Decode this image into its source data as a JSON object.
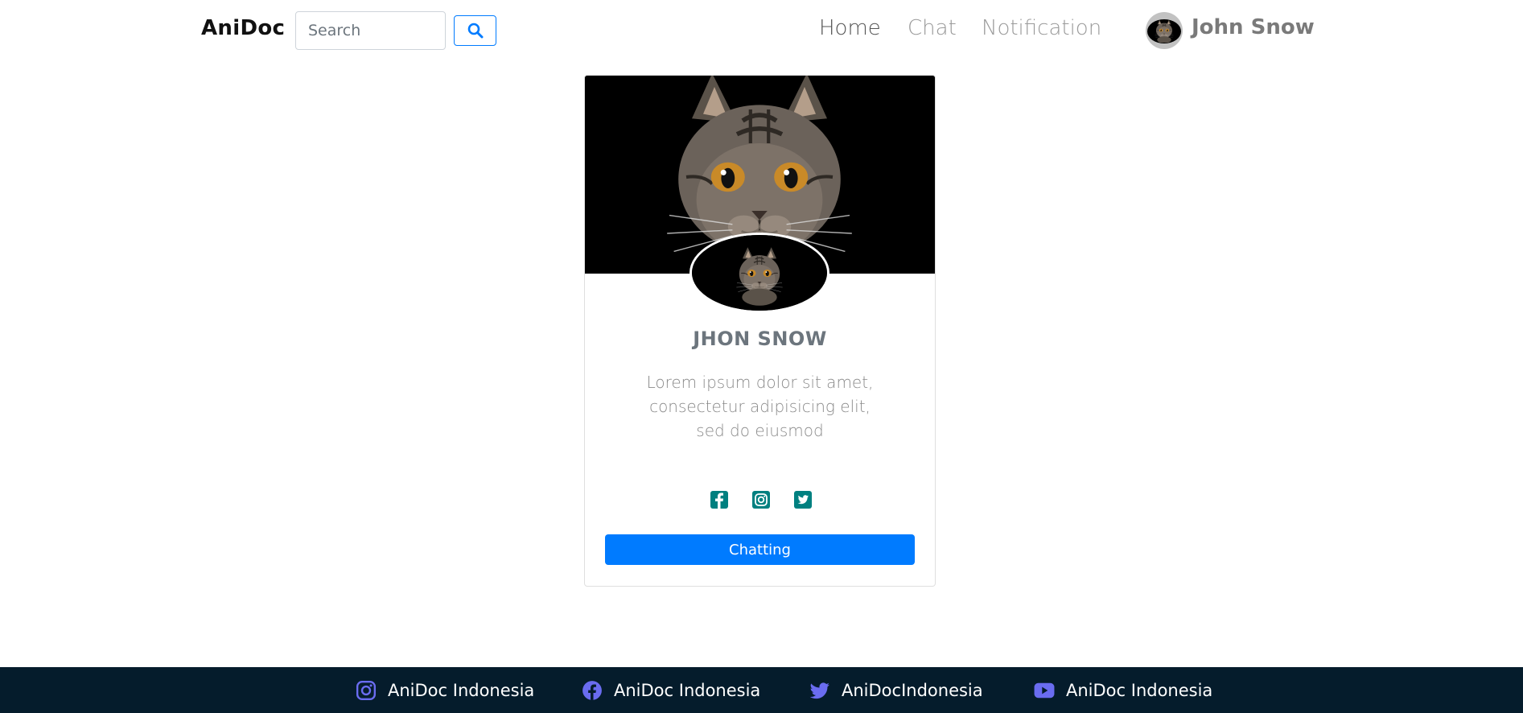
{
  "navbar": {
    "brand": "AniDoc",
    "search_placeholder": "Search",
    "links": {
      "home": "Home",
      "chat": "Chat",
      "notification": "Notification"
    },
    "user_name": "John Snow",
    "icons": {
      "search": "search-icon",
      "avatar": "cat-avatar"
    }
  },
  "profile": {
    "name": "JHON SNOW",
    "description_lines": [
      "Lorem ipsum dolor sit amet,",
      "consectetur adipisicing elit,",
      "sed do eiusmod"
    ],
    "social_icons": [
      "facebook-square-icon",
      "instagram-square-icon",
      "twitter-square-icon"
    ],
    "social_color": "#008080",
    "button_label": "Chatting",
    "button_color": "#007bff"
  },
  "footer": {
    "background": "#051c2c",
    "icon_color": "#6a6cf0",
    "items": [
      {
        "icon": "instagram-icon",
        "label": "AniDoc Indonesia"
      },
      {
        "icon": "facebook-icon",
        "label": "AniDoc Indonesia"
      },
      {
        "icon": "twitter-icon",
        "label": "AniDocIndonesia"
      },
      {
        "icon": "youtube-icon",
        "label": "AniDoc Indonesia"
      }
    ]
  }
}
